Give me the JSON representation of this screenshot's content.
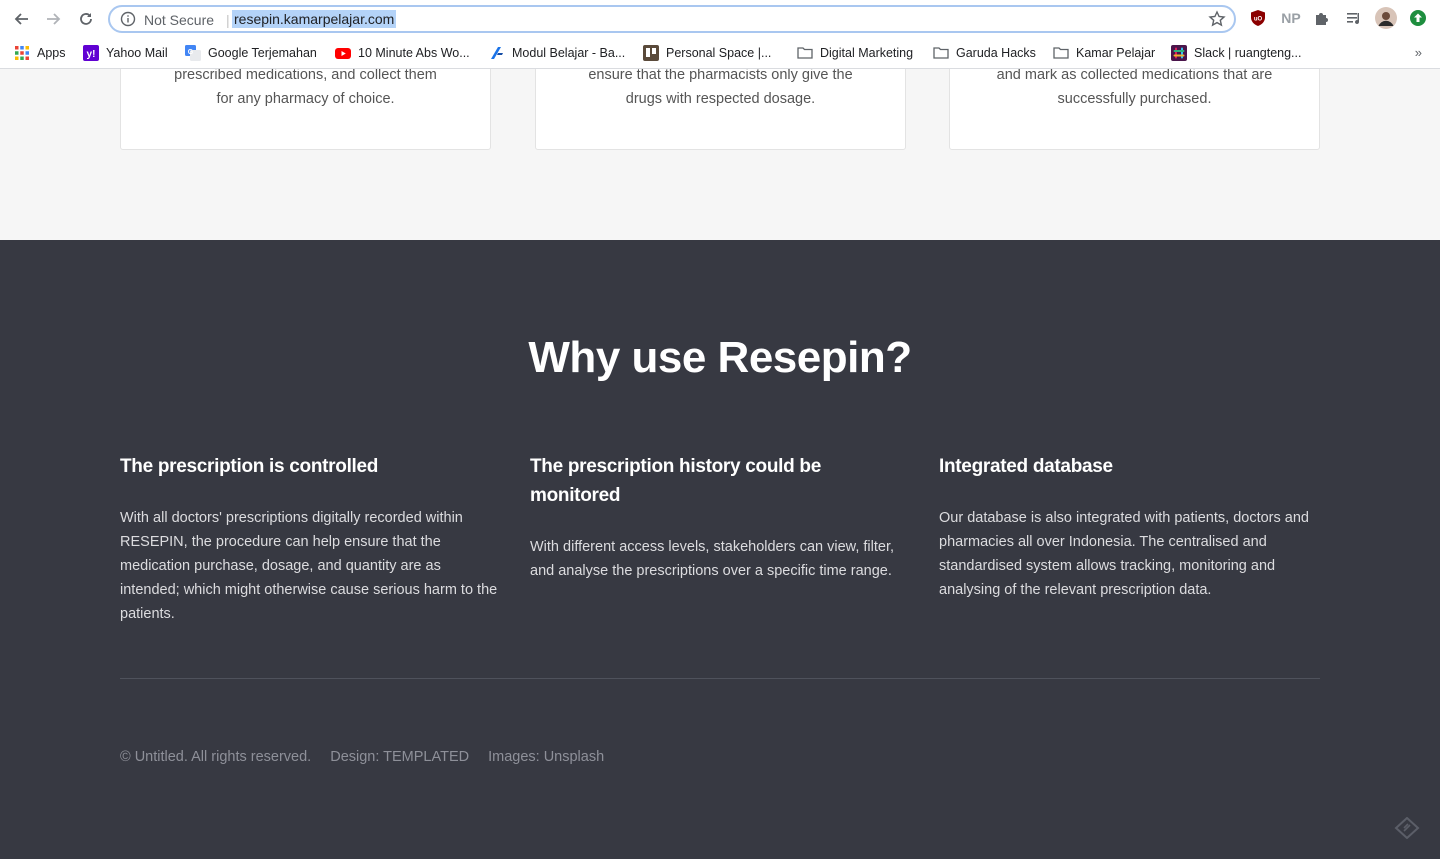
{
  "browser": {
    "security_label": "Not Secure",
    "separator": "|",
    "url": "resepin.kamarpelajar.com"
  },
  "bookmarks": [
    {
      "label": "Apps",
      "icon": "apps-grid-icon"
    },
    {
      "label": "Yahoo Mail",
      "icon": "yahoo-icon"
    },
    {
      "label": "Google Terjemahan",
      "icon": "google-translate-icon"
    },
    {
      "label": "10 Minute Abs Wo...",
      "icon": "youtube-icon"
    },
    {
      "label": "Modul Belajar - Ba...",
      "icon": "modul-icon"
    },
    {
      "label": "Personal Space |...",
      "icon": "trello-icon"
    },
    {
      "label": "Digital Marketing",
      "icon": "folder-icon"
    },
    {
      "label": "Garuda Hacks",
      "icon": "folder-icon"
    },
    {
      "label": "Kamar Pelajar",
      "icon": "folder-icon"
    },
    {
      "label": "Slack | ruangteng...",
      "icon": "slack-icon"
    }
  ],
  "bookmarks_overflow": "»",
  "extensions": {
    "np_label": "NP"
  },
  "cards": [
    {
      "line_partial": "prescribed medications, and collect them",
      "line_last": "for any pharmacy of choice."
    },
    {
      "line_partial": "ensure that the pharmacists only give the",
      "line_last": "drugs with respected dosage."
    },
    {
      "line_partial": "and mark as collected medications that are",
      "line_last": "successfully purchased."
    }
  ],
  "why": {
    "heading": "Why use Resepin?",
    "features": [
      {
        "title": "The prescription is controlled",
        "body": "With all doctors' prescriptions digitally recorded within RESEPIN, the procedure can help ensure that the medication purchase, dosage, and quantity are as intended; which might otherwise cause serious harm to the patients."
      },
      {
        "title": "The prescription history could be monitored",
        "body": "With different access levels, stakeholders can view, filter, and analyse the prescriptions over a specific time range."
      },
      {
        "title": "Integrated database",
        "body": "Our database is also integrated with patients, doctors and pharmacies all over Indonesia. The centralised and standardised system allows tracking, monitoring and analysing of the relevant prescription data."
      }
    ]
  },
  "footer": {
    "copyright": "© Untitled. All rights reserved.",
    "design": "Design: TEMPLATED",
    "images": "Images: Unsplash"
  },
  "colors": {
    "dark_bg": "#373942",
    "light_bg": "#f6f6f6",
    "url_highlight": "#b4d3f8"
  }
}
